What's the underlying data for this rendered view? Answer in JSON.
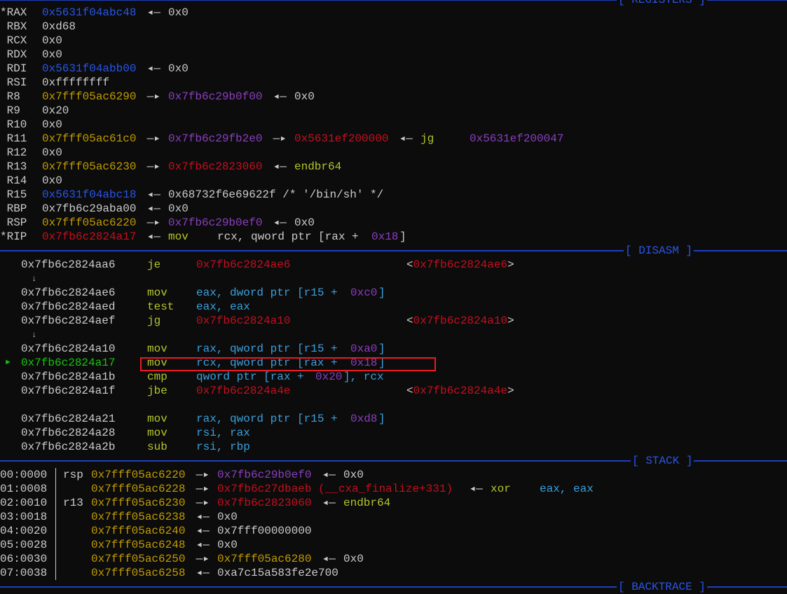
{
  "colors": {
    "bg": "#0c0c0c",
    "plain": "#cccccc",
    "blue": "#2955ea",
    "yellow": "#c19c00",
    "purple": "#8a3fbf",
    "red": "#c50f1f",
    "green": "#16c60c",
    "lime": "#b5c52a",
    "cyan": "#3aa0de",
    "header": "#2a55e8",
    "highlight": "#e81b23"
  },
  "sections": {
    "registers": "[ REGISTERS ]",
    "disasm": "[ DISASM ]",
    "stack": "[ STACK ]",
    "backtrace": "[ BACKTRACE ]"
  },
  "registers": [
    {
      "name": "*RAX",
      "parts": [
        {
          "text": "0x5631f04abc48",
          "c": "blue"
        },
        {
          "text": " ◂— ",
          "c": "plain"
        },
        {
          "text": "0x0",
          "c": "plain"
        }
      ]
    },
    {
      "name": " RBX",
      "parts": [
        {
          "text": "0xd68",
          "c": "plain"
        }
      ]
    },
    {
      "name": " RCX",
      "parts": [
        {
          "text": "0x0",
          "c": "plain"
        }
      ]
    },
    {
      "name": " RDX",
      "parts": [
        {
          "text": "0x0",
          "c": "plain"
        }
      ]
    },
    {
      "name": " RDI",
      "parts": [
        {
          "text": "0x5631f04abb00",
          "c": "blue"
        },
        {
          "text": " ◂— ",
          "c": "plain"
        },
        {
          "text": "0x0",
          "c": "plain"
        }
      ]
    },
    {
      "name": " RSI",
      "parts": [
        {
          "text": "0xffffffff",
          "c": "plain"
        }
      ]
    },
    {
      "name": " R8",
      "parts": [
        {
          "text": "0x7fff05ac6290",
          "c": "yellow"
        },
        {
          "text": " —▸ ",
          "c": "plain"
        },
        {
          "text": "0x7fb6c29b0f00",
          "c": "purple"
        },
        {
          "text": " ◂— ",
          "c": "plain"
        },
        {
          "text": "0x0",
          "c": "plain"
        }
      ]
    },
    {
      "name": " R9",
      "parts": [
        {
          "text": "0x20",
          "c": "plain"
        }
      ]
    },
    {
      "name": " R10",
      "parts": [
        {
          "text": "0x0",
          "c": "plain"
        }
      ]
    },
    {
      "name": " R11",
      "parts": [
        {
          "text": "0x7fff05ac61c0",
          "c": "yellow"
        },
        {
          "text": " —▸ ",
          "c": "plain"
        },
        {
          "text": "0x7fb6c29fb2e0",
          "c": "purple"
        },
        {
          "text": " —▸ ",
          "c": "plain"
        },
        {
          "text": "0x5631ef200000",
          "c": "red"
        },
        {
          "text": " ◂— ",
          "c": "plain"
        },
        {
          "text": "jg     ",
          "c": "lime"
        },
        {
          "text": "0x5631ef200047",
          "c": "purple"
        }
      ]
    },
    {
      "name": " R12",
      "parts": [
        {
          "text": "0x0",
          "c": "plain"
        }
      ]
    },
    {
      "name": " R13",
      "parts": [
        {
          "text": "0x7fff05ac6230",
          "c": "yellow"
        },
        {
          "text": " —▸ ",
          "c": "plain"
        },
        {
          "text": "0x7fb6c2823060",
          "c": "red"
        },
        {
          "text": " ◂— ",
          "c": "plain"
        },
        {
          "text": "endbr64",
          "c": "lime"
        }
      ]
    },
    {
      "name": " R14",
      "parts": [
        {
          "text": "0x0",
          "c": "plain"
        }
      ]
    },
    {
      "name": " R15",
      "parts": [
        {
          "text": "0x5631f04abc18",
          "c": "blue"
        },
        {
          "text": " ◂— ",
          "c": "plain"
        },
        {
          "text": "0x68732f6e69622f /* '/bin/sh' */",
          "c": "plain"
        }
      ]
    },
    {
      "name": " RBP",
      "parts": [
        {
          "text": "0x7fb6c29aba00",
          "c": "plain"
        },
        {
          "text": " ◂— ",
          "c": "plain"
        },
        {
          "text": "0x0",
          "c": "plain"
        }
      ]
    },
    {
      "name": " RSP",
      "parts": [
        {
          "text": "0x7fff05ac6220",
          "c": "yellow"
        },
        {
          "text": " —▸ ",
          "c": "plain"
        },
        {
          "text": "0x7fb6c29b0ef0",
          "c": "purple"
        },
        {
          "text": " ◂— ",
          "c": "plain"
        },
        {
          "text": "0x0",
          "c": "plain"
        }
      ]
    },
    {
      "name": "*RIP",
      "parts": [
        {
          "text": "0x7fb6c2824a17",
          "c": "red"
        },
        {
          "text": " ◂— ",
          "c": "plain"
        },
        {
          "text": "mov    ",
          "c": "lime"
        },
        {
          "text": "rcx, qword ptr [rax + ",
          "c": "plain"
        },
        {
          "text": "0x18",
          "c": "purple"
        },
        {
          "text": "]",
          "c": "plain"
        }
      ]
    }
  ],
  "disasm": [
    {
      "addr": "0x7fb6c2824aa6",
      "mnem": "je",
      "ops": [
        {
          "text": "0x7fb6c2824ae6",
          "c": "red"
        }
      ],
      "target": "<0x7fb6c2824ae6>"
    },
    {
      "arrow": "↓"
    },
    {
      "addr": "0x7fb6c2824ae6",
      "mnem": "mov",
      "ops": [
        {
          "text": "eax, dword ptr [r15 + ",
          "c": "cyan"
        },
        {
          "text": "0xc0",
          "c": "purple"
        },
        {
          "text": "]",
          "c": "cyan"
        }
      ]
    },
    {
      "addr": "0x7fb6c2824aed",
      "mnem": "test",
      "ops": [
        {
          "text": "eax, eax",
          "c": "cyan"
        }
      ]
    },
    {
      "addr": "0x7fb6c2824aef",
      "mnem": "jg",
      "ops": [
        {
          "text": "0x7fb6c2824a10",
          "c": "red"
        }
      ],
      "target": "<0x7fb6c2824a10>"
    },
    {
      "arrow": "↓"
    },
    {
      "addr": "0x7fb6c2824a10",
      "mnem": "mov",
      "ops": [
        {
          "text": "rax, qword ptr [r15 + ",
          "c": "cyan"
        },
        {
          "text": "0xa0",
          "c": "purple"
        },
        {
          "text": "]",
          "c": "cyan"
        }
      ]
    },
    {
      "addr": "0x7fb6c2824a17",
      "mnem": "mov",
      "current": true,
      "marker": "►",
      "ops": [
        {
          "text": "rcx, qword ptr [rax + ",
          "c": "cyan"
        },
        {
          "text": "0x18",
          "c": "purple"
        },
        {
          "text": "]",
          "c": "cyan"
        }
      ]
    },
    {
      "addr": "0x7fb6c2824a1b",
      "mnem": "cmp",
      "ops": [
        {
          "text": "qword ptr [rax + ",
          "c": "cyan"
        },
        {
          "text": "0x20",
          "c": "purple"
        },
        {
          "text": "], rcx",
          "c": "cyan"
        }
      ]
    },
    {
      "addr": "0x7fb6c2824a1f",
      "mnem": "jbe",
      "ops": [
        {
          "text": "0x7fb6c2824a4e",
          "c": "red"
        }
      ],
      "target": "<0x7fb6c2824a4e>"
    },
    {
      "blank": true
    },
    {
      "addr": "0x7fb6c2824a21",
      "mnem": "mov",
      "ops": [
        {
          "text": "rax, qword ptr [r15 + ",
          "c": "cyan"
        },
        {
          "text": "0xd8",
          "c": "purple"
        },
        {
          "text": "]",
          "c": "cyan"
        }
      ]
    },
    {
      "addr": "0x7fb6c2824a28",
      "mnem": "mov",
      "ops": [
        {
          "text": "rsi, rax",
          "c": "cyan"
        }
      ]
    },
    {
      "addr": "0x7fb6c2824a2b",
      "mnem": "sub",
      "ops": [
        {
          "text": "rsi, rbp",
          "c": "cyan"
        }
      ]
    }
  ],
  "stack": [
    {
      "off": "00:0000",
      "reg": "rsp",
      "parts": [
        {
          "text": "0x7fff05ac6220",
          "c": "yellow"
        },
        {
          "text": " —▸ ",
          "c": "plain"
        },
        {
          "text": "0x7fb6c29b0ef0",
          "c": "purple"
        },
        {
          "text": " ◂— ",
          "c": "plain"
        },
        {
          "text": "0x0",
          "c": "plain"
        }
      ]
    },
    {
      "off": "01:0008",
      "reg": "",
      "parts": [
        {
          "text": "0x7fff05ac6228",
          "c": "yellow"
        },
        {
          "text": " —▸ ",
          "c": "plain"
        },
        {
          "text": "0x7fb6c27dbaeb (__cxa_finalize+331)",
          "c": "red"
        },
        {
          "text": " ◂— ",
          "c": "plain"
        },
        {
          "text": "xor    ",
          "c": "lime"
        },
        {
          "text": "eax, eax",
          "c": "cyan"
        }
      ]
    },
    {
      "off": "02:0010",
      "reg": "r13",
      "parts": [
        {
          "text": "0x7fff05ac6230",
          "c": "yellow"
        },
        {
          "text": " —▸ ",
          "c": "plain"
        },
        {
          "text": "0x7fb6c2823060",
          "c": "red"
        },
        {
          "text": " ◂— ",
          "c": "plain"
        },
        {
          "text": "endbr64",
          "c": "lime"
        }
      ]
    },
    {
      "off": "03:0018",
      "reg": "",
      "parts": [
        {
          "text": "0x7fff05ac6238",
          "c": "yellow"
        },
        {
          "text": " ◂— ",
          "c": "plain"
        },
        {
          "text": "0x0",
          "c": "plain"
        }
      ]
    },
    {
      "off": "04:0020",
      "reg": "",
      "parts": [
        {
          "text": "0x7fff05ac6240",
          "c": "yellow"
        },
        {
          "text": " ◂— ",
          "c": "plain"
        },
        {
          "text": "0x7fff00000000",
          "c": "plain"
        }
      ]
    },
    {
      "off": "05:0028",
      "reg": "",
      "parts": [
        {
          "text": "0x7fff05ac6248",
          "c": "yellow"
        },
        {
          "text": " ◂— ",
          "c": "plain"
        },
        {
          "text": "0x0",
          "c": "plain"
        }
      ]
    },
    {
      "off": "06:0030",
      "reg": "",
      "parts": [
        {
          "text": "0x7fff05ac6250",
          "c": "yellow"
        },
        {
          "text": " —▸ ",
          "c": "plain"
        },
        {
          "text": "0x7fff05ac6280",
          "c": "yellow"
        },
        {
          "text": " ◂— ",
          "c": "plain"
        },
        {
          "text": "0x0",
          "c": "plain"
        }
      ]
    },
    {
      "off": "07:0038",
      "reg": "",
      "parts": [
        {
          "text": "0x7fff05ac6258",
          "c": "yellow"
        },
        {
          "text": " ◂— ",
          "c": "plain"
        },
        {
          "text": "0xa7c15a583fe2e700",
          "c": "plain"
        }
      ]
    }
  ]
}
